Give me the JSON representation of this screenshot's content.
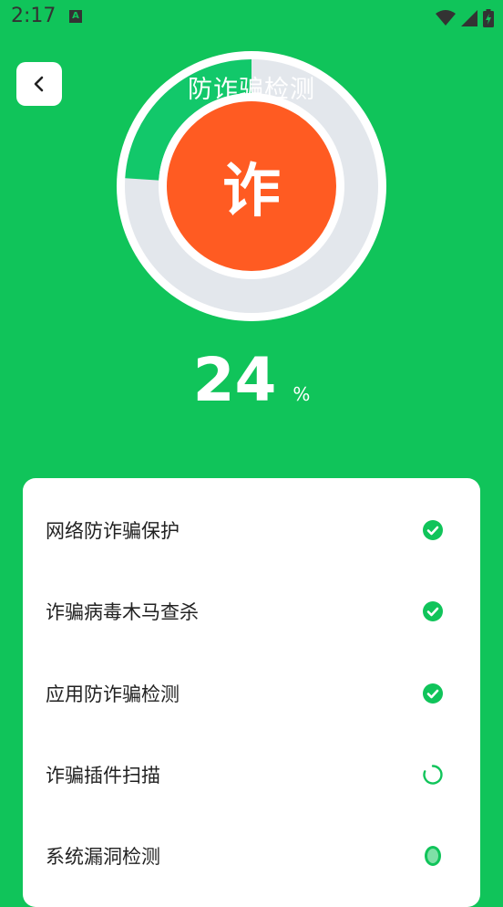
{
  "status_bar": {
    "time": "2:17",
    "left_icon": "A",
    "icons": [
      "wifi-icon",
      "signal-icon",
      "battery-icon"
    ]
  },
  "header": {
    "back_icon": "chevron-left-icon",
    "title": "防诈骗检测"
  },
  "scan": {
    "core_char": "诈",
    "progress_percent": 24,
    "percent_value": "24",
    "percent_unit": "%"
  },
  "checklist": {
    "items": [
      {
        "label": "网络防诈骗保护",
        "status": "done",
        "icon": "check-circle-icon"
      },
      {
        "label": "诈骗病毒木马查杀",
        "status": "done",
        "icon": "check-circle-icon"
      },
      {
        "label": "应用防诈骗检测",
        "status": "done",
        "icon": "check-circle-icon"
      },
      {
        "label": "诈骗插件扫描",
        "status": "scanning",
        "icon": "loading-ring-icon"
      },
      {
        "label": "系统漏洞检测",
        "status": "pending",
        "icon": "loading-dot-icon"
      }
    ]
  },
  "colors": {
    "background": "#10c45a",
    "ring_track": "#e3e7ec",
    "ring_progress": "#12c86a",
    "core": "#ff5b22",
    "check": "#10c45a"
  }
}
